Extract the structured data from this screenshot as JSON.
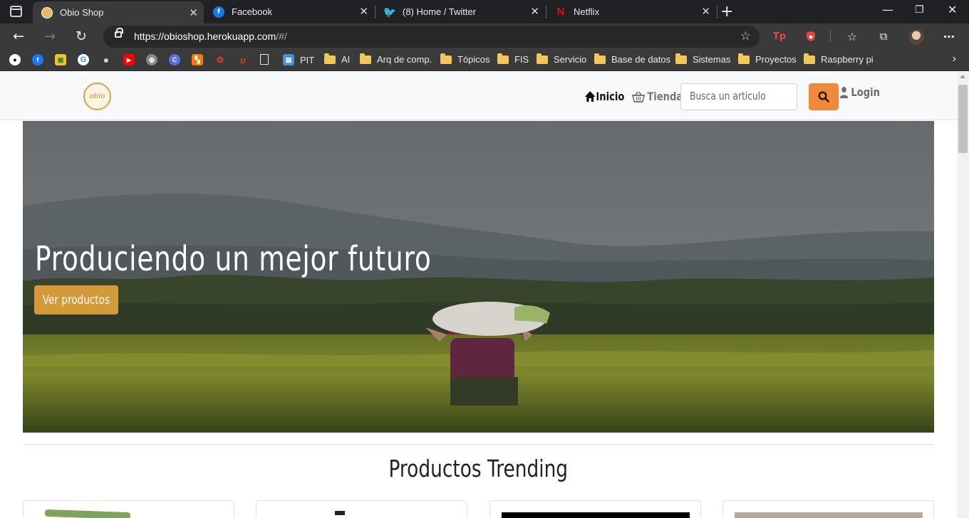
{
  "browser": {
    "tabs": [
      {
        "title": "Obio Shop",
        "active": true,
        "favicon": "obio-favicon"
      },
      {
        "title": "Facebook",
        "active": false,
        "favicon": "facebook-favicon"
      },
      {
        "title": "(8) Home / Twitter",
        "active": false,
        "favicon": "twitter-favicon"
      },
      {
        "title": "Netflix",
        "active": false,
        "favicon": "netflix-favicon"
      }
    ],
    "url_main": "https://obioshop.herokuapp.com",
    "url_rest": "/#/",
    "bookmarks": {
      "pit": "PIT",
      "ai": "AI",
      "arq": "Arq de comp.",
      "topicos": "Tópicos",
      "fis": "FIS",
      "servicio": "Servicio",
      "bd": "Base de datos",
      "sistemas": "Sistemas",
      "proyectos": "Proyectos",
      "raspberry": "Raspberry pi"
    }
  },
  "site": {
    "logo_text": "obio",
    "nav": {
      "inicio": "Inicio",
      "tienda": "Tienda",
      "login": "Login"
    },
    "search": {
      "placeholder": "Busca un articulo"
    },
    "hero": {
      "title": "Produciendo un mejor futuro",
      "button": "Ver productos"
    },
    "trending_title": "Productos Trending"
  },
  "colors": {
    "accent_orange": "#f08a3a",
    "hero_button": "#d49a3a",
    "browser_dark": "#202124"
  }
}
